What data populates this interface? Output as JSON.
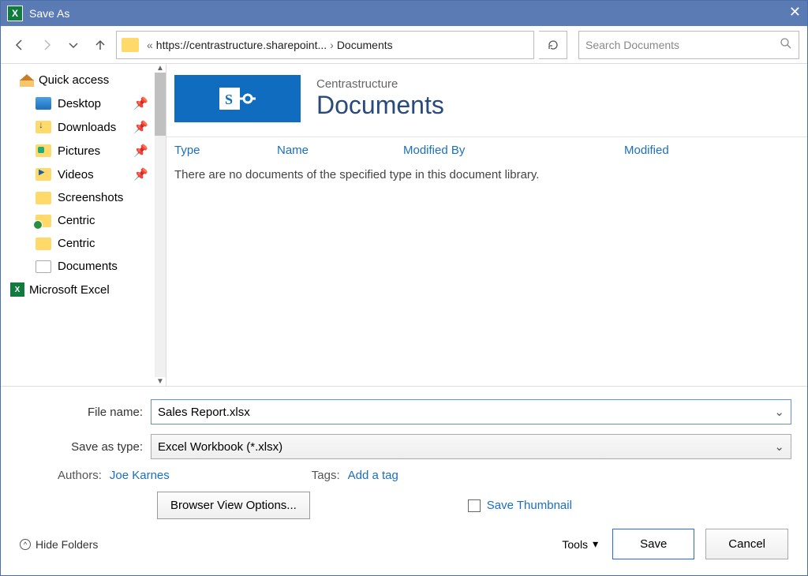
{
  "window": {
    "title": "Save As"
  },
  "nav": {
    "address_prefix": "«",
    "crumbs": [
      "https://centrastructure.sharepoint...",
      "Documents"
    ],
    "search_placeholder": "Search Documents"
  },
  "sidebar": {
    "quick_access_label": "Quick access",
    "items": [
      {
        "label": "Desktop",
        "pinned": true,
        "icon": "desk"
      },
      {
        "label": "Downloads",
        "pinned": true,
        "icon": "dl"
      },
      {
        "label": "Pictures",
        "pinned": true,
        "icon": "pic"
      },
      {
        "label": "Videos",
        "pinned": true,
        "icon": "vid"
      },
      {
        "label": "Screenshots",
        "pinned": false,
        "icon": "sq"
      },
      {
        "label": "Centric",
        "pinned": false,
        "icon": "sync"
      },
      {
        "label": "Centric",
        "pinned": false,
        "icon": "sq"
      },
      {
        "label": "Documents",
        "pinned": false,
        "icon": "doc"
      }
    ],
    "excel_label": "Microsoft Excel"
  },
  "content": {
    "site_name": "Centrastructure",
    "library_name": "Documents",
    "columns": {
      "type": "Type",
      "name": "Name",
      "modified_by": "Modified By",
      "modified": "Modified"
    },
    "empty_message": "There are no documents of the specified type in this document library."
  },
  "form": {
    "filename_label": "File name:",
    "filename_value": "Sales Report.xlsx",
    "savetype_label": "Save as type:",
    "savetype_value": "Excel Workbook (*.xlsx)",
    "authors_label": "Authors:",
    "authors_value": "Joe Karnes",
    "tags_label": "Tags:",
    "tags_value": "Add a tag",
    "browser_view_label": "Browser View Options...",
    "save_thumbnail_label": "Save Thumbnail",
    "hide_folders_label": "Hide Folders",
    "tools_label": "Tools",
    "save_label": "Save",
    "cancel_label": "Cancel"
  }
}
